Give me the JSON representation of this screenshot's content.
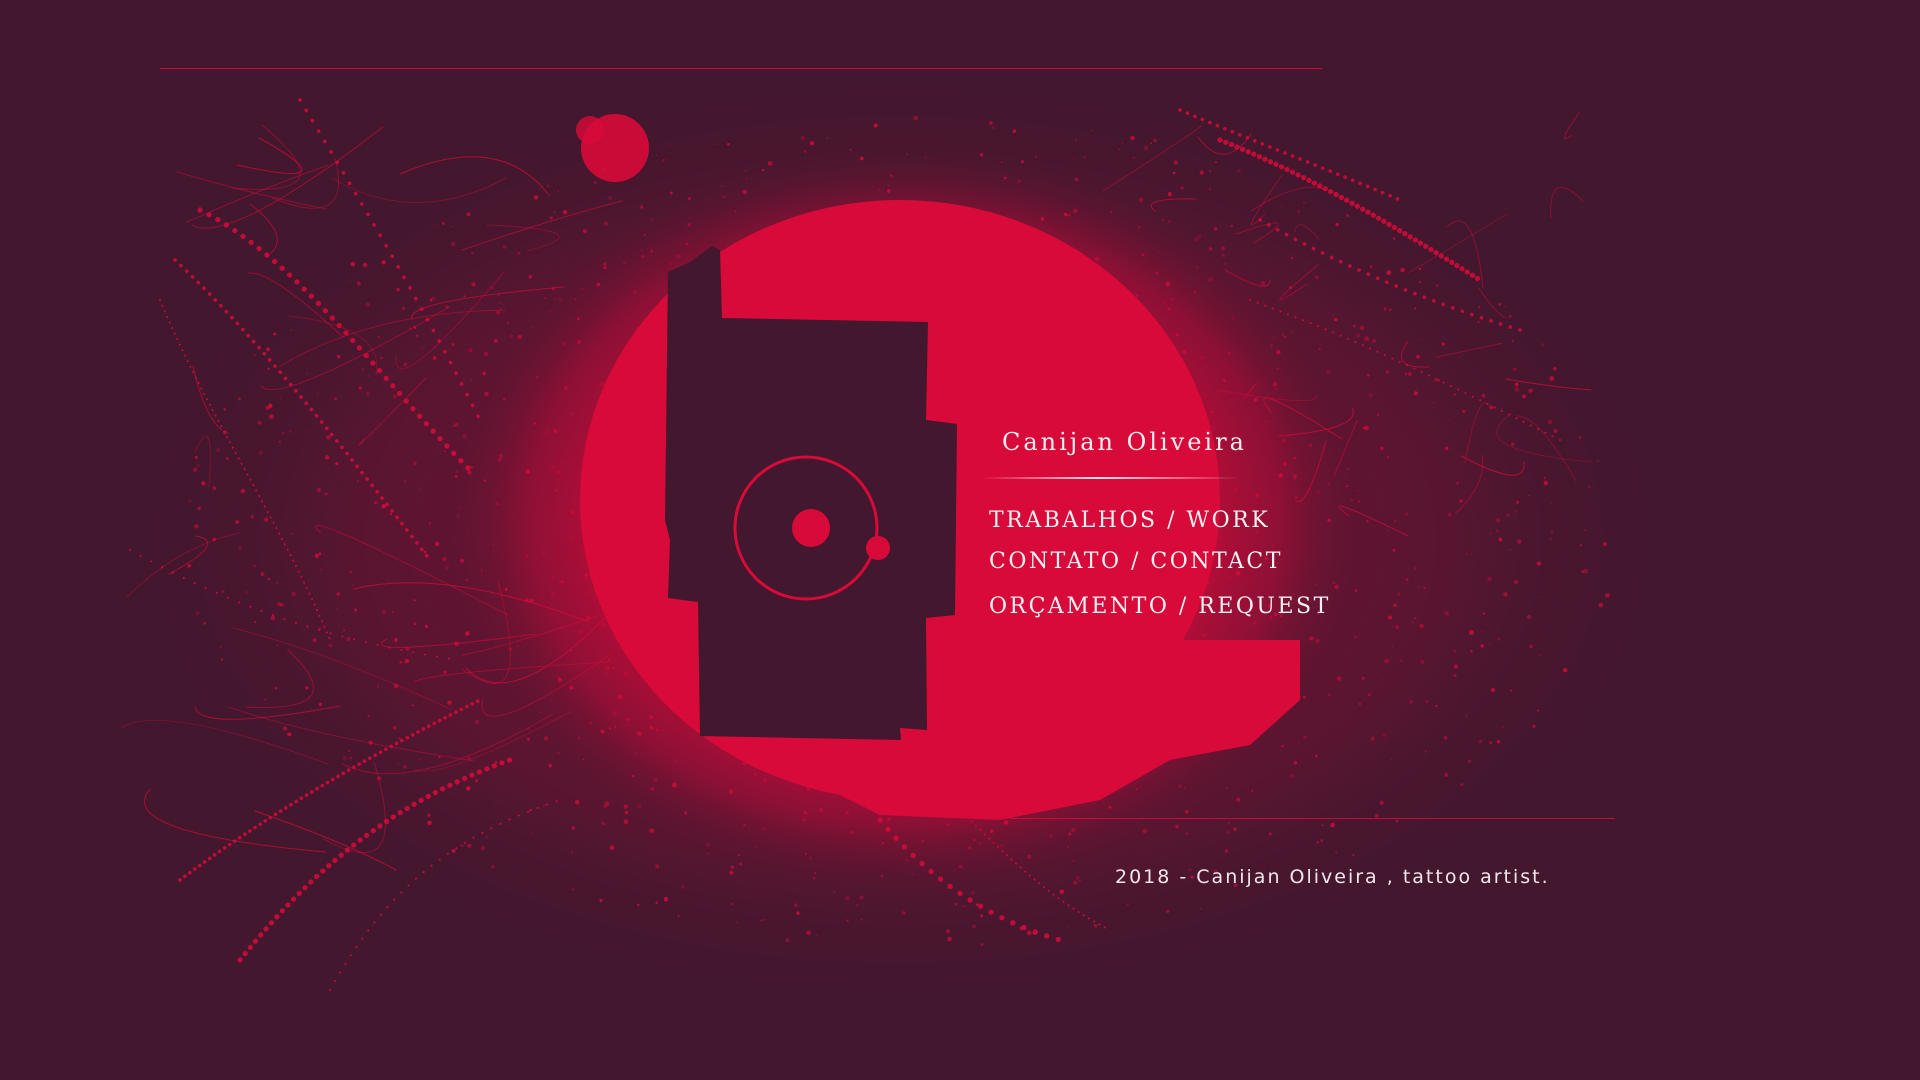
{
  "brand": {
    "name": "Canijan Oliveira",
    "logo_icon": "orbit-circle-icon"
  },
  "nav": {
    "items": [
      {
        "label": "TRABALHOS / WORK"
      },
      {
        "label": "CONTATO / CONTACT"
      },
      {
        "label": "ORÇAMENTO / REQUEST"
      }
    ]
  },
  "footer": {
    "credit": "2018 - Canijan Oliveira , tattoo artist."
  },
  "colors": {
    "background": "#43172e",
    "accent_red": "#d80a3a",
    "text": "#f6eef1"
  }
}
